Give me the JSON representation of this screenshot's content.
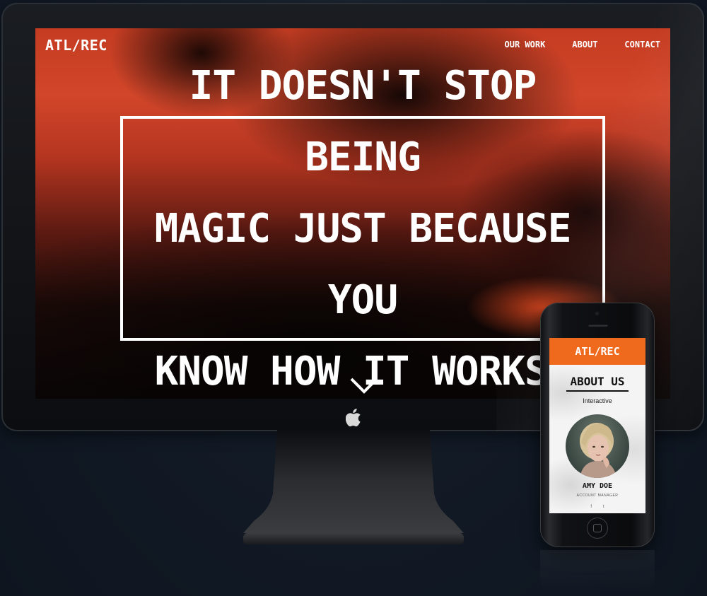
{
  "desktop_site": {
    "logo": "ATL/REC",
    "nav": [
      {
        "label": "OUR WORK"
      },
      {
        "label": "ABOUT"
      },
      {
        "label": "CONTACT"
      }
    ],
    "hero_lines": [
      "IT DOESN'T STOP BEING",
      "MAGIC JUST BECAUSE YOU",
      "KNOW HOW IT WORKS."
    ],
    "scroll_icon": "chevron-down-icon"
  },
  "mobile_site": {
    "logo": "ATL/REC",
    "section_title": "ABOUT US",
    "subtitle": "Interactive",
    "person_name": "AMY DOE",
    "person_role": "ACCOUNT MANAGER",
    "social": [
      {
        "glyph": "f",
        "icon": "facebook-icon"
      },
      {
        "glyph": "t",
        "icon": "twitter-icon"
      }
    ]
  },
  "colors": {
    "hero_red": "#c43c22",
    "mobile_header_orange": "#f06a1e",
    "background_navy": "#121a26"
  }
}
